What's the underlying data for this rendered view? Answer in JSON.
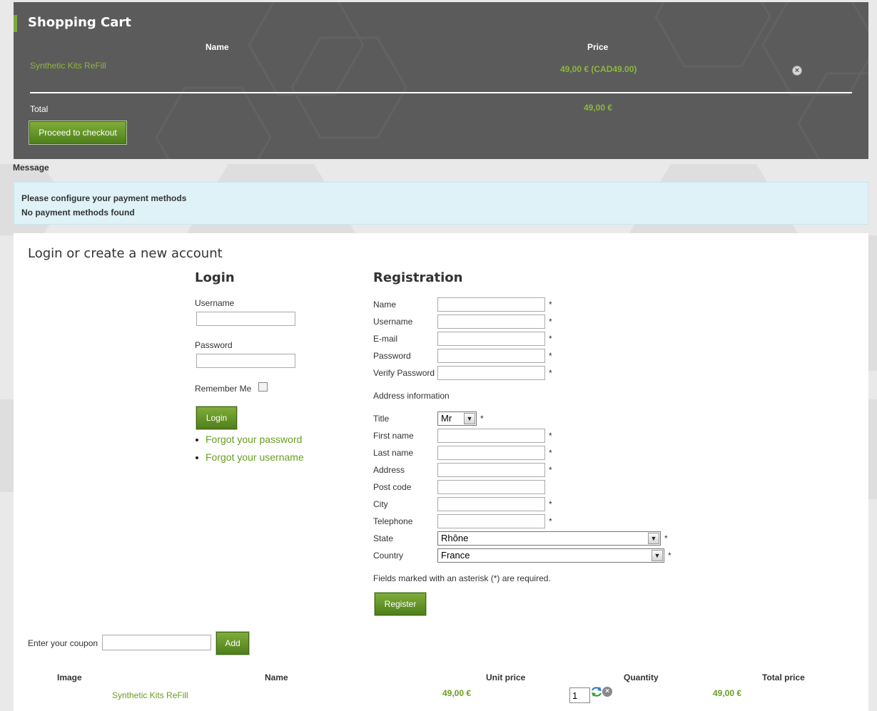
{
  "cart": {
    "title": "Shopping Cart",
    "col_name": "Name",
    "col_price": "Price",
    "item_name": "Synthetic Kits ReFill",
    "item_price": "49,00 € (CAD49.00)",
    "remove_icon": "close-circle-icon",
    "total_label": "Total",
    "total_value": "49,00 €",
    "checkout_label": "Proceed to checkout"
  },
  "message": {
    "label": "Message",
    "lines": [
      "Please configure your payment methods",
      "No payment methods found"
    ]
  },
  "account": {
    "title": "Login or create a new account",
    "login": {
      "title": "Login",
      "username_label": "Username",
      "password_label": "Password",
      "remember_label": "Remember Me",
      "login_button": "Login",
      "forgot_password": "Forgot your password",
      "forgot_username": "Forgot your username"
    },
    "registration": {
      "title": "Registration",
      "fields": [
        "Name",
        "Username",
        "E-mail",
        "Password",
        "Verify Password"
      ],
      "address_heading": "Address information",
      "title_label": "Title",
      "title_value": "Mr",
      "address_fields": [
        "First name",
        "Last name",
        "Address",
        "Post code",
        "City",
        "Telephone"
      ],
      "state_label": "State",
      "state_value": "Rhône",
      "country_label": "Country",
      "country_value": "France",
      "required_note": "Fields marked with an asterisk (*) are required.",
      "register_button": "Register",
      "asterisk": "*"
    }
  },
  "coupon": {
    "label": "Enter your coupon",
    "add_button": "Add"
  },
  "summary": {
    "headers": [
      "Image",
      "Name",
      "Unit price",
      "Quantity",
      "Total price"
    ],
    "row": {
      "name": "Synthetic Kits ReFill",
      "unit_price": "49,00 €",
      "quantity": "1",
      "total_price": "49,00 €"
    },
    "refresh_icon": "refresh-icon",
    "remove_icon": "close-circle-icon"
  },
  "colors": {
    "accent_green": "#6a9d22",
    "cart_bg": "#5b5b5b",
    "notice_bg": "#dff2f8"
  }
}
